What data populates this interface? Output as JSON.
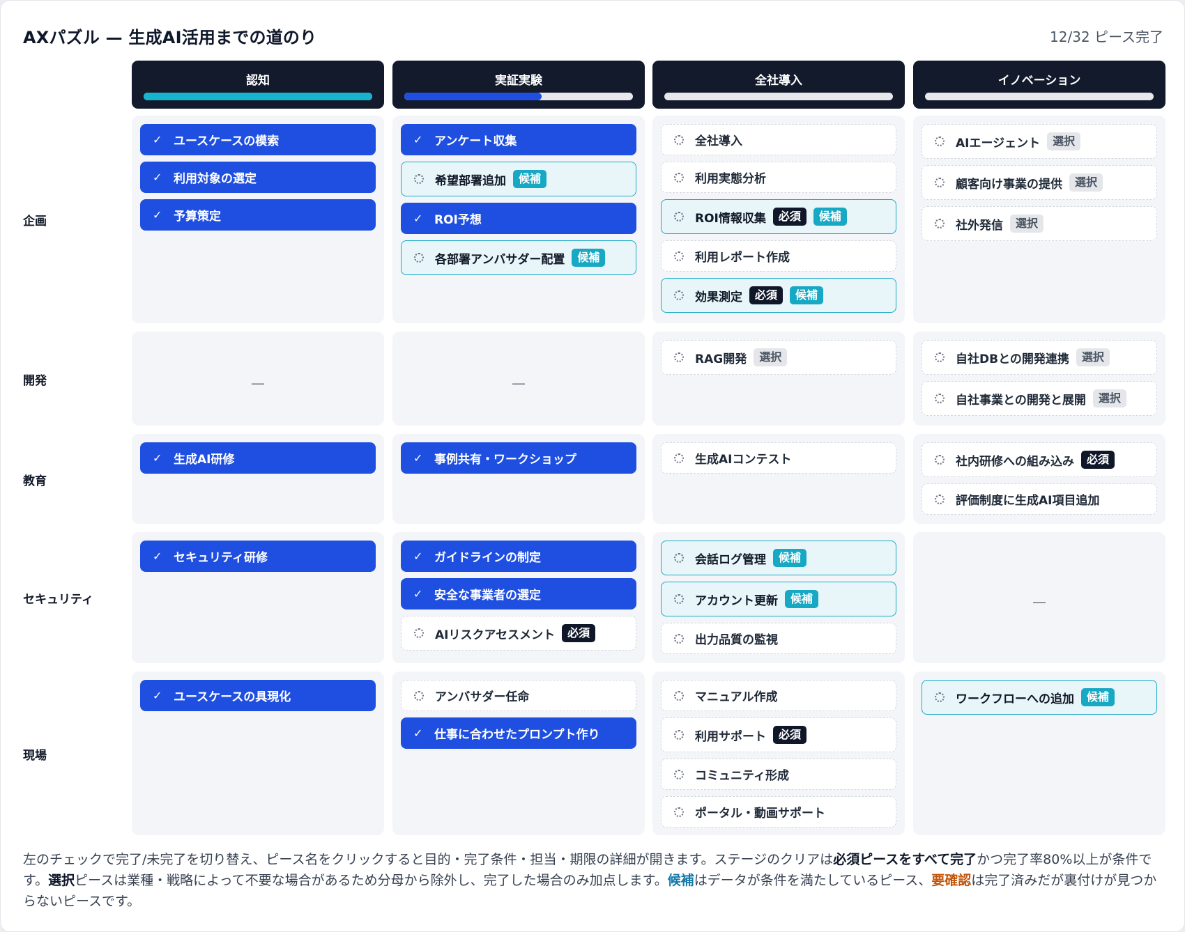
{
  "title": "AXパズル — 生成AI活用までの道のり",
  "progress_text": "12/32 ピース完了",
  "colors": {
    "header_bg": "#121a2c",
    "done_piece": "#1f4fe0",
    "candidate_border": "#16a9c6",
    "stage1_fill": "#16b4cf",
    "stage2_fill": "#1f4fe0"
  },
  "icons": {
    "done": "check-icon",
    "todo": "dotted-circle-icon"
  },
  "stages": [
    {
      "label": "認知",
      "progress": 1.0
    },
    {
      "label": "実証実験",
      "progress": 0.6
    },
    {
      "label": "全社導入",
      "progress": 0.0
    },
    {
      "label": "イノベーション",
      "progress": 0.0
    }
  ],
  "rows": [
    "企画",
    "開発",
    "教育",
    "セキュリティ",
    "現場"
  ],
  "empty_mark": "—",
  "badges": {
    "required": "必須",
    "candidate": "候補",
    "optional": "選択"
  },
  "grid": {
    "r0c0": [
      {
        "label": "ユースケースの模索",
        "done": true
      },
      {
        "label": "利用対象の選定",
        "done": true
      },
      {
        "label": "予算策定",
        "done": true
      }
    ],
    "r0c1": [
      {
        "label": "アンケート収集",
        "done": true
      },
      {
        "label": "希望部署追加",
        "done": false,
        "candidate": true
      },
      {
        "label": "ROI予想",
        "done": true
      },
      {
        "label": "各部署アンバサダー配置",
        "done": false,
        "candidate": true
      }
    ],
    "r0c2": [
      {
        "label": "全社導入",
        "done": false
      },
      {
        "label": "利用実態分析",
        "done": false
      },
      {
        "label": "ROI情報収集",
        "done": false,
        "required": true,
        "candidate": true
      },
      {
        "label": "利用レポート作成",
        "done": false
      },
      {
        "label": "効果測定",
        "done": false,
        "required": true,
        "candidate": true
      }
    ],
    "r0c3": [
      {
        "label": "AIエージェント",
        "done": false,
        "optional": true
      },
      {
        "label": "顧客向け事業の提供",
        "done": false,
        "optional": true
      },
      {
        "label": "社外発信",
        "done": false,
        "optional": true
      }
    ],
    "r1c0": [],
    "r1c1": [],
    "r1c2": [
      {
        "label": "RAG開発",
        "done": false,
        "optional": true
      }
    ],
    "r1c3": [
      {
        "label": "自社DBとの開発連携",
        "done": false,
        "optional": true
      },
      {
        "label": "自社事業との開発と展開",
        "done": false,
        "optional": true
      }
    ],
    "r2c0": [
      {
        "label": "生成AI研修",
        "done": true
      }
    ],
    "r2c1": [
      {
        "label": "事例共有・ワークショップ",
        "done": true
      }
    ],
    "r2c2": [
      {
        "label": "生成AIコンテスト",
        "done": false
      }
    ],
    "r2c3": [
      {
        "label": "社内研修への組み込み",
        "done": false,
        "required": true
      },
      {
        "label": "評価制度に生成AI項目追加",
        "done": false
      }
    ],
    "r3c0": [
      {
        "label": "セキュリティ研修",
        "done": true
      }
    ],
    "r3c1": [
      {
        "label": "ガイドラインの制定",
        "done": true
      },
      {
        "label": "安全な事業者の選定",
        "done": true
      },
      {
        "label": "AIリスクアセスメント",
        "done": false,
        "required": true
      }
    ],
    "r3c2": [
      {
        "label": "会話ログ管理",
        "done": false,
        "candidate": true
      },
      {
        "label": "アカウント更新",
        "done": false,
        "candidate": true
      },
      {
        "label": "出力品質の監視",
        "done": false
      }
    ],
    "r3c3": [],
    "r4c0": [
      {
        "label": "ユースケースの具現化",
        "done": true
      }
    ],
    "r4c1": [
      {
        "label": "アンバサダー任命",
        "done": false
      },
      {
        "label": "仕事に合わせたプロンプト作り",
        "done": true
      }
    ],
    "r4c2": [
      {
        "label": "マニュアル作成",
        "done": false
      },
      {
        "label": "利用サポート",
        "done": false,
        "required": true
      },
      {
        "label": "コミュニティ形成",
        "done": false
      },
      {
        "label": "ポータル・動画サポート",
        "done": false
      }
    ],
    "r4c3": [
      {
        "label": "ワークフローへの追加",
        "done": false,
        "candidate": true
      }
    ]
  },
  "footer": {
    "t1": "左のチェックで完了/未完了を切り替え、ピース名をクリックすると目的・完了条件・担当・期限の詳細が開きます。ステージのクリアは",
    "b1": "必須ピースをすべて完了",
    "t2": "かつ完了率80%以上が条件です。",
    "b2": "選択",
    "t3": "ピースは業種・戦略によって不要な場合があるため分母から除外し、完了した場合のみ加点します。",
    "c1": "候補",
    "t4": "はデータが条件を満たしているピース、",
    "c2": "要確認",
    "t5": "は完了済みだが裏付けが見つからないピースです。"
  }
}
